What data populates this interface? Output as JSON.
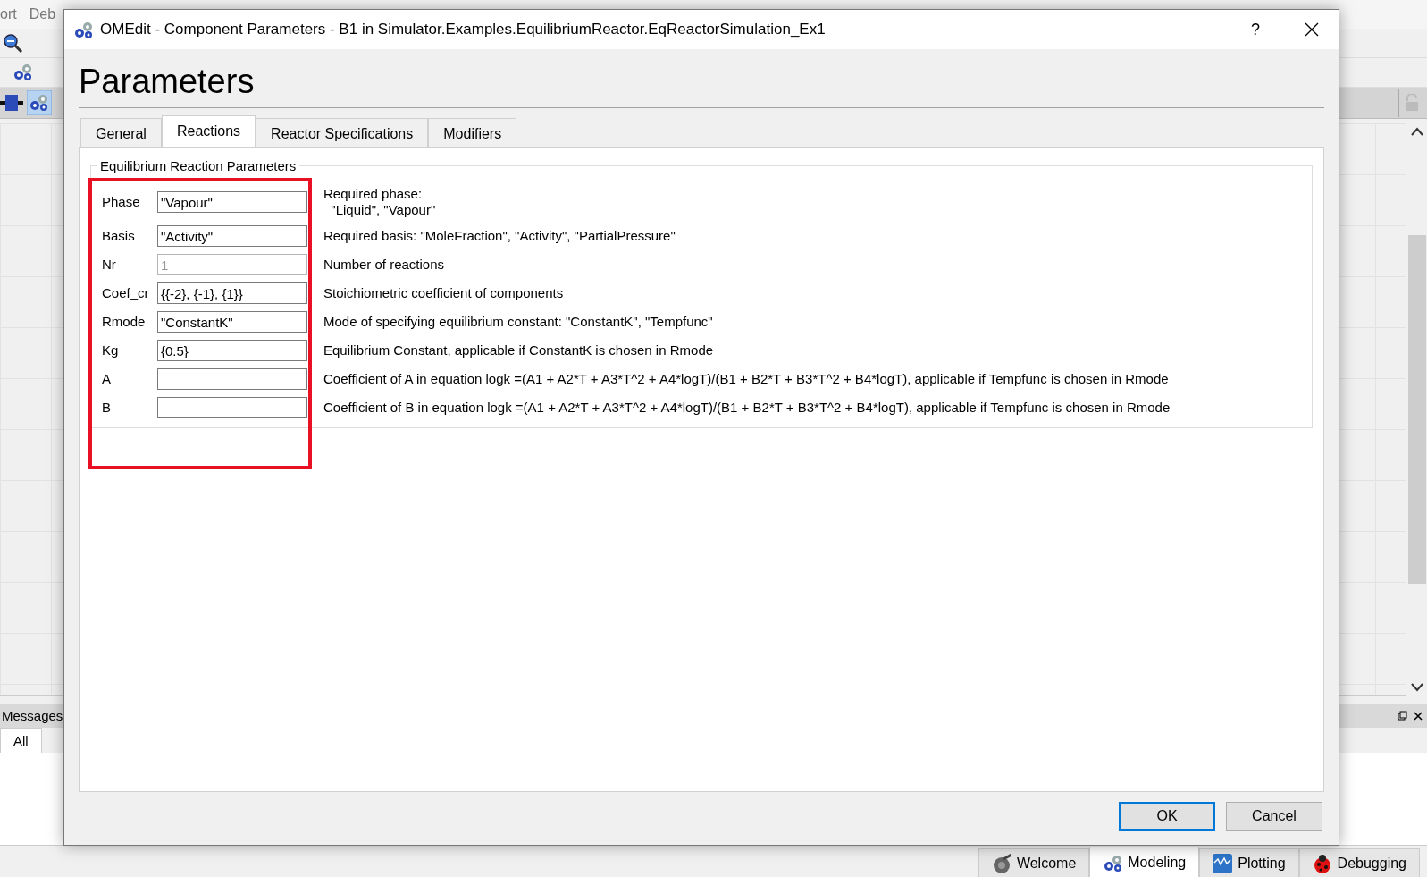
{
  "app": {
    "menu": [
      "ort",
      "Deb"
    ],
    "messages_title": "Messages",
    "message_tabs": [
      {
        "label": "All",
        "selected": true
      }
    ],
    "perspectives": [
      {
        "label": "Welcome",
        "kind": "welcome",
        "selected": false
      },
      {
        "label": "Modeling",
        "kind": "modeling",
        "selected": true
      },
      {
        "label": "Plotting",
        "kind": "plotting",
        "selected": false
      },
      {
        "label": "Debugging",
        "kind": "debugging",
        "selected": false
      }
    ]
  },
  "dialog": {
    "title": "OMEdit - Component Parameters - B1 in Simulator.Examples.EquilibriumReactor.EqReactorSimulation_Ex1",
    "help": "?",
    "heading": "Parameters",
    "tabs": [
      {
        "label": "General",
        "selected": false
      },
      {
        "label": "Reactions",
        "selected": true
      },
      {
        "label": "Reactor Specifications",
        "selected": false
      },
      {
        "label": "Modifiers",
        "selected": false
      }
    ],
    "group_title": "Equilibrium Reaction Parameters",
    "parameters": [
      {
        "name": "Phase",
        "value": "\"Vapour\"",
        "disabled": false,
        "description": "Required phase:\n  \"Liquid\", \"Vapour\""
      },
      {
        "name": "Basis",
        "value": "\"Activity\"",
        "disabled": false,
        "description": "Required basis: \"MoleFraction\", \"Activity\", \"PartialPressure\""
      },
      {
        "name": "Nr",
        "value": "1",
        "disabled": true,
        "description": "Number of reactions"
      },
      {
        "name": "Coef_cr",
        "value": "{{-2}, {-1}, {1}}",
        "disabled": false,
        "description": "Stoichiometric coefficient of components"
      },
      {
        "name": "Rmode",
        "value": "\"ConstantK\"",
        "disabled": false,
        "description": "Mode of specifying equilibrium constant: \"ConstantK\", \"Tempfunc\""
      },
      {
        "name": "Kg",
        "value": "{0.5}",
        "disabled": false,
        "description": "Equilibrium Constant, applicable if ConstantK is chosen in Rmode"
      },
      {
        "name": "A",
        "disabled": false,
        "description": "Coefficient of A in equation logk =(A1 + A2*T + A3*T^2 + A4*logT)/(B1 + B2*T + B3*T^2 + B4*logT), applicable if Tempfunc is chosen in Rmode"
      },
      {
        "name": "B",
        "disabled": false,
        "description": "Coefficient of B in equation logk =(A1 + A2*T + A3*T^2 + A4*logT)/(B1 + B2*T + B3*T^2 + B4*logT), applicable if Tempfunc is chosen in Rmode"
      }
    ],
    "buttons": [
      {
        "label": "OK",
        "default": true
      },
      {
        "label": "Cancel",
        "default": false
      }
    ]
  }
}
